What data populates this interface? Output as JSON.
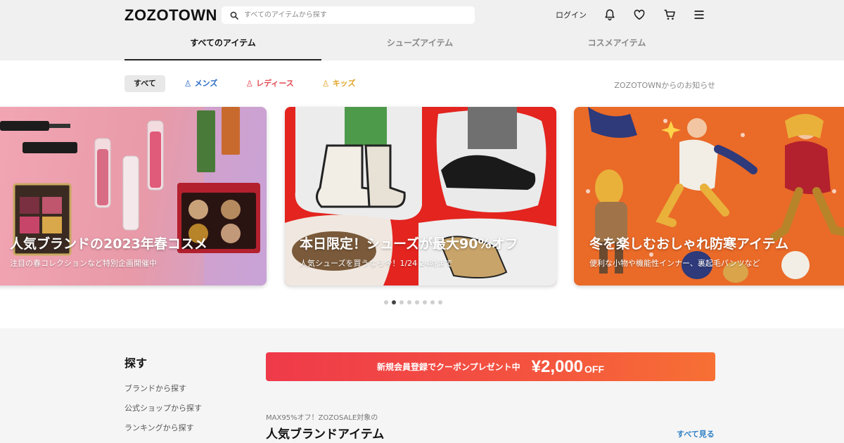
{
  "header": {
    "logo": "ZOZOTOWN",
    "search_placeholder": "すべてのアイテムから探す",
    "login": "ログイン",
    "icons": [
      "bell-icon",
      "heart-icon",
      "cart-icon",
      "menu-icon"
    ]
  },
  "tabs": [
    {
      "label": "すべてのアイテム",
      "active": true
    },
    {
      "label": "シューズアイテム",
      "active": false
    },
    {
      "label": "コスメアイテム",
      "active": false
    }
  ],
  "filters": {
    "all": "すべて",
    "mens": "メンズ",
    "ladies": "レディース",
    "kids": "キッズ",
    "colors": {
      "mens": "#2b6cc4",
      "ladies": "#e24a52",
      "kids": "#e2a428"
    }
  },
  "notice": "ZOZOTOWNからのお知らせ",
  "banners": [
    {
      "title": "人気ブランドの2023年春コスメ",
      "subtitle": "注目の春コレクションなど特別企画開催中"
    },
    {
      "title": "本日限定！シューズが最大90%オフ",
      "subtitle": "人気シューズを買うなら今！1/24 24時まで"
    },
    {
      "title": "冬を楽しむおしゃれ防寒アイテム",
      "subtitle": "便利な小物や機能性インナー、裏起毛パンツなど"
    }
  ],
  "carousel": {
    "count": 8,
    "active_index": 1
  },
  "sidebar": {
    "title": "探す",
    "links": [
      "ブランドから探す",
      "公式ショップから探す",
      "ランキングから探す"
    ]
  },
  "coupon": {
    "text": "新規会員登録でクーポンプレゼント中",
    "amount": "¥2,000",
    "off": "OFF"
  },
  "section": {
    "subtitle": "MAX95%オフ！ZOZOSALE対象の",
    "title": "人気ブランドアイテム",
    "see_all": "すべて見る"
  },
  "colors": {
    "accent": "#2f80c5",
    "coupon": "#ef3a4a"
  }
}
